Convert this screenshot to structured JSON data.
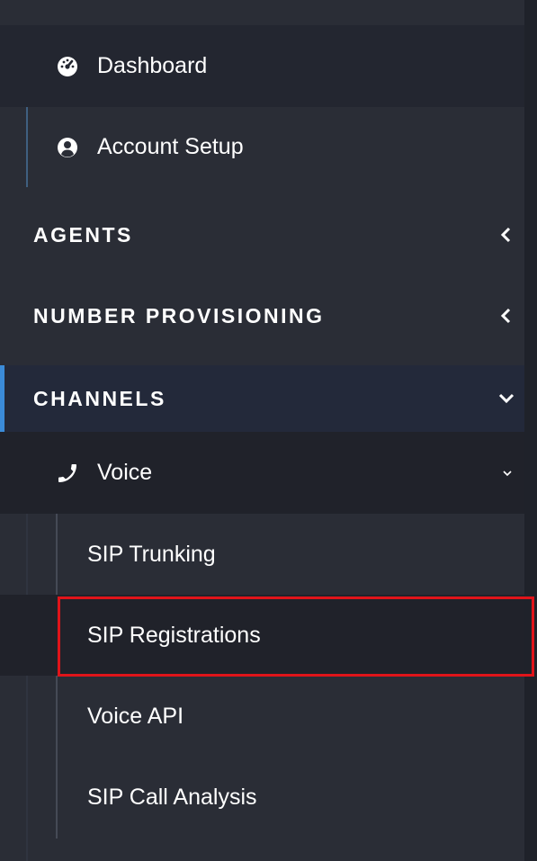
{
  "sidebar": {
    "dashboard": {
      "label": "Dashboard",
      "icon": "gauge-icon"
    },
    "account_setup": {
      "label": "Account Setup",
      "icon": "user-circle-icon"
    },
    "sections": [
      {
        "label": "AGENTS",
        "expanded": false
      },
      {
        "label": "NUMBER PROVISIONING",
        "expanded": false
      },
      {
        "label": "CHANNELS",
        "expanded": true
      }
    ],
    "voice": {
      "label": "Voice",
      "icon": "phone-icon",
      "expanded": true
    },
    "voice_items": [
      {
        "label": "SIP Trunking"
      },
      {
        "label": "SIP Registrations",
        "highlighted": true
      },
      {
        "label": "Voice API"
      },
      {
        "label": "SIP Call Analysis"
      }
    ]
  },
  "colors": {
    "sidebar_bg": "#2a2d36",
    "active_row_bg": "#232630",
    "channels_bg": "#23293a",
    "accent": "#3b8bd8",
    "highlight": "#e0141a"
  }
}
